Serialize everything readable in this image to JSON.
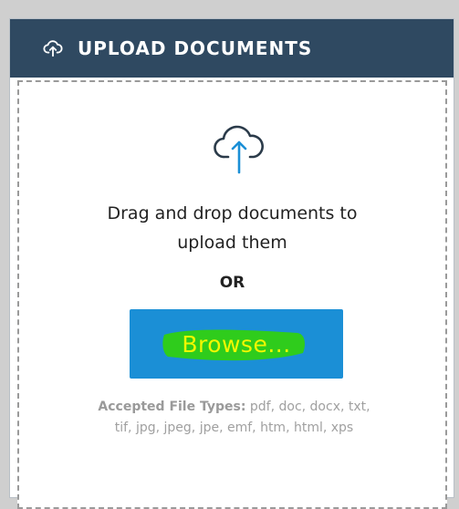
{
  "panel": {
    "header_title": "UPLOAD DOCUMENTS",
    "header_icon": "cloud-upload-icon"
  },
  "dropzone": {
    "icon": "cloud-upload-icon",
    "instruction_line1": "Drag and drop documents to",
    "instruction_line2": "upload them",
    "or_label": "OR",
    "browse_label": "Browse...",
    "accepted_label": "Accepted File Types:",
    "accepted_line1": "pdf, doc, docx, txt,",
    "accepted_line2": "tif, jpg, jpeg, jpe, emf, htm, html, xps"
  },
  "colors": {
    "header_bg": "#2f4961",
    "button_bg": "#1b8fd6",
    "highlight": "#2fcc1c",
    "icon_accent": "#1b8fd6"
  }
}
